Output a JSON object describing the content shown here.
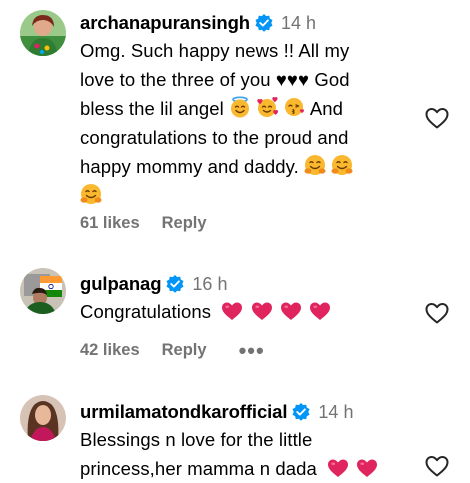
{
  "comments": [
    {
      "username": "archanapuransingh",
      "time": "14 h",
      "lines": [
        "Omg. Such happy news !! All my",
        "love to the three of you ♥♥♥ God",
        "bless the lil angel",
        "congratulations to the proud and",
        "happy mommy and daddy."
      ],
      "line3_suffix": "And",
      "likes": "61 likes",
      "reply": "Reply"
    },
    {
      "username": "gulpanag",
      "time": "16 h",
      "lines": [
        "Congratulations"
      ],
      "likes": "42 likes",
      "reply": "Reply",
      "more": "•••"
    },
    {
      "username": "urmilamatondkarofficial",
      "time": "14 h",
      "lines": [
        "Blessings n love for the little",
        "princess,her mamma n dada"
      ]
    }
  ],
  "icons": {
    "verified": "verified-badge-icon",
    "heart": "heart-outline-icon",
    "red_heart": "red-heart-emoji",
    "hug": "hugging-face-emoji",
    "angel": "smiling-face-with-halo-emoji",
    "hearts_face": "smiling-face-with-hearts-emoji",
    "kiss": "face-blowing-kiss-emoji"
  },
  "colors": {
    "verified_blue": "#0095f6",
    "muted_text": "#737373",
    "red_heart": "#e0245e"
  }
}
